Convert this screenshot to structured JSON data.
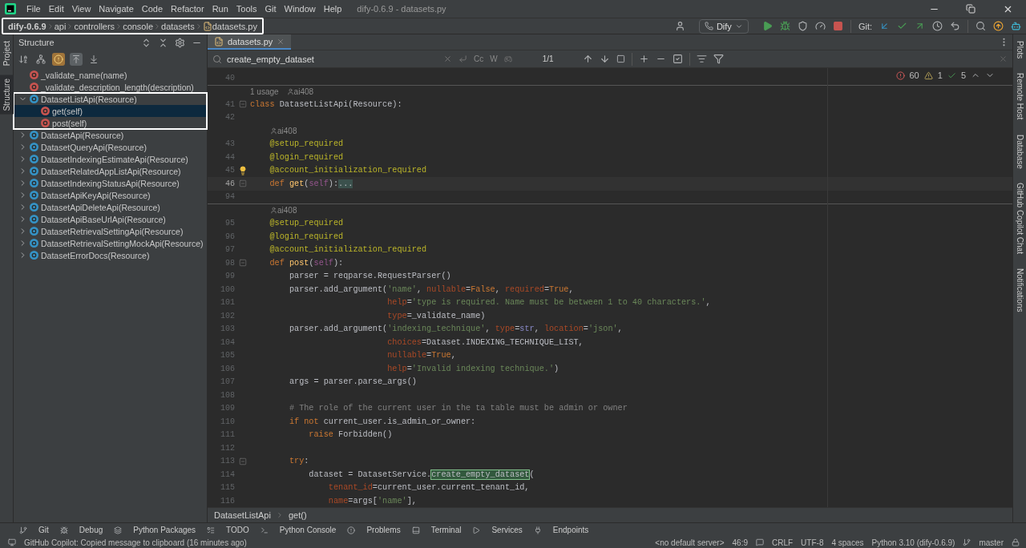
{
  "window": {
    "title": "dify-0.6.9 - datasets.py"
  },
  "menu": [
    "File",
    "Edit",
    "View",
    "Navigate",
    "Code",
    "Refactor",
    "Run",
    "Tools",
    "Git",
    "Window",
    "Help"
  ],
  "breadcrumb": {
    "framed": true,
    "items": [
      {
        "kind": "project",
        "text": "dify-0.6.9"
      },
      {
        "kind": "folder",
        "text": "api"
      },
      {
        "kind": "folder",
        "text": "controllers"
      },
      {
        "kind": "folder",
        "text": "console"
      },
      {
        "kind": "folder",
        "text": "datasets"
      },
      {
        "kind": "file",
        "text": "datasets.py"
      }
    ]
  },
  "toolbar": {
    "run_config": "Dify",
    "git_label": "Git:"
  },
  "left_stripe": [
    {
      "label": "Project",
      "selected": false
    },
    {
      "label": "Structure",
      "selected": true
    }
  ],
  "right_stripe": [
    "Plots",
    "Remote Host",
    "Database",
    "GitHub Copilot Chat",
    "Notifications"
  ],
  "structure": {
    "title": "Structure",
    "toggles": [
      {
        "kind": "sort",
        "on": false
      },
      {
        "kind": "hierarchy",
        "on": false
      },
      {
        "kind": "fields",
        "on": true
      },
      {
        "kind": "inherited",
        "on": true
      },
      {
        "kind": "down",
        "on": false
      }
    ],
    "items": [
      {
        "kind": "function",
        "text": "_validate_name(name)",
        "selected": false
      },
      {
        "kind": "function",
        "text": "_validate_description_length(description)",
        "selected": false
      },
      {
        "kind": "class",
        "text": "DatasetListApi(Resource)",
        "selected": false,
        "expanded": true,
        "framed": true,
        "children": [
          {
            "kind": "method",
            "text": "get(self)",
            "selected": true
          },
          {
            "kind": "method",
            "text": "post(self)",
            "selected": false
          }
        ]
      },
      {
        "kind": "class",
        "text": "DatasetApi(Resource)",
        "selected": false,
        "expanded": false
      },
      {
        "kind": "class",
        "text": "DatasetQueryApi(Resource)",
        "selected": false,
        "expanded": false
      },
      {
        "kind": "class",
        "text": "DatasetIndexingEstimateApi(Resource)",
        "selected": false,
        "expanded": false
      },
      {
        "kind": "class",
        "text": "DatasetRelatedAppListApi(Resource)",
        "selected": false,
        "expanded": false
      },
      {
        "kind": "class",
        "text": "DatasetIndexingStatusApi(Resource)",
        "selected": false,
        "expanded": false
      },
      {
        "kind": "class",
        "text": "DatasetApiKeyApi(Resource)",
        "selected": false,
        "expanded": false
      },
      {
        "kind": "class",
        "text": "DatasetApiDeleteApi(Resource)",
        "selected": false,
        "expanded": false
      },
      {
        "kind": "class",
        "text": "DatasetApiBaseUrlApi(Resource)",
        "selected": false,
        "expanded": false
      },
      {
        "kind": "class",
        "text": "DatasetRetrievalSettingApi(Resource)",
        "selected": false,
        "expanded": false
      },
      {
        "kind": "class",
        "text": "DatasetRetrievalSettingMockApi(Resource)",
        "selected": false,
        "expanded": false
      },
      {
        "kind": "class",
        "text": "DatasetErrorDocs(Resource)",
        "selected": false,
        "expanded": false
      }
    ]
  },
  "tabs": [
    {
      "label": "datasets.py",
      "selected": true
    }
  ],
  "find": {
    "value": "create_empty_dataset",
    "options": [
      "Cc",
      "W"
    ],
    "count": "1/1"
  },
  "inspections": {
    "errors": "60",
    "warnings": "1",
    "typos": "5"
  },
  "code": [
    {
      "kind": "line",
      "n": "40",
      "current": false
    },
    {
      "kind": "inlay",
      "separator": true,
      "nested": false,
      "usages": "1 usage",
      "author": "ai408"
    },
    {
      "kind": "line",
      "n": "41",
      "current": false,
      "foldable": true,
      "tokens": [
        {
          "kind": "k",
          "text": "class "
        },
        {
          "kind": "p",
          "text": "DatasetListApi(Resource):"
        }
      ]
    },
    {
      "kind": "line",
      "n": "42",
      "current": false
    },
    {
      "kind": "inlay",
      "separator": false,
      "nested": true,
      "author": "ai408"
    },
    {
      "kind": "line",
      "n": "43",
      "current": false,
      "tokens": [
        {
          "kind": "d",
          "text": "    @setup_required"
        }
      ]
    },
    {
      "kind": "line",
      "n": "44",
      "current": false,
      "tokens": [
        {
          "kind": "d",
          "text": "    @login_required"
        }
      ]
    },
    {
      "kind": "line",
      "n": "45",
      "current": false,
      "bulb": true,
      "tokens": [
        {
          "kind": "d",
          "text": "    @account_initialization_required"
        }
      ]
    },
    {
      "kind": "line",
      "n": "46",
      "current": true,
      "foldable": true,
      "tokens": [
        {
          "kind": "k",
          "text": "    def "
        },
        {
          "kind": "f",
          "text": "get"
        },
        {
          "kind": "p",
          "text": "("
        },
        {
          "kind": "s",
          "text": "self"
        },
        {
          "kind": "p",
          "text": "):"
        },
        {
          "kind": "fold",
          "text": "..."
        }
      ]
    },
    {
      "kind": "line",
      "n": "94",
      "current": false
    },
    {
      "kind": "inlay",
      "separator": true,
      "nested": true,
      "author": "ai408"
    },
    {
      "kind": "line",
      "n": "95",
      "current": false,
      "tokens": [
        {
          "kind": "d",
          "text": "    @setup_required"
        }
      ]
    },
    {
      "kind": "line",
      "n": "96",
      "current": false,
      "tokens": [
        {
          "kind": "d",
          "text": "    @login_required"
        }
      ]
    },
    {
      "kind": "line",
      "n": "97",
      "current": false,
      "tokens": [
        {
          "kind": "d",
          "text": "    @account_initialization_required"
        }
      ]
    },
    {
      "kind": "line",
      "n": "98",
      "current": false,
      "foldable": true,
      "tokens": [
        {
          "kind": "k",
          "text": "    def "
        },
        {
          "kind": "f",
          "text": "post"
        },
        {
          "kind": "p",
          "text": "("
        },
        {
          "kind": "s",
          "text": "self"
        },
        {
          "kind": "p",
          "text": "):"
        }
      ]
    },
    {
      "kind": "line",
      "n": "99",
      "current": false,
      "tokens": [
        {
          "kind": "p",
          "text": "        parser = reqparse.RequestParser()"
        }
      ]
    },
    {
      "kind": "line",
      "n": "100",
      "current": false,
      "tokens": [
        {
          "kind": "p",
          "text": "        parser.add_argument("
        },
        {
          "kind": "str",
          "text": "'name'"
        },
        {
          "kind": "p",
          "text": ", "
        },
        {
          "kind": "n",
          "text": "nullable"
        },
        {
          "kind": "p",
          "text": "="
        },
        {
          "kind": "k",
          "text": "False"
        },
        {
          "kind": "p",
          "text": ", "
        },
        {
          "kind": "n",
          "text": "required"
        },
        {
          "kind": "p",
          "text": "="
        },
        {
          "kind": "k",
          "text": "True"
        },
        {
          "kind": "p",
          "text": ","
        }
      ]
    },
    {
      "kind": "line",
      "n": "101",
      "current": false,
      "tokens": [
        {
          "kind": "n",
          "text": "                            help"
        },
        {
          "kind": "p",
          "text": "="
        },
        {
          "kind": "str",
          "text": "'type is required. Name must be between 1 to 40 characters.'"
        },
        {
          "kind": "p",
          "text": ","
        }
      ]
    },
    {
      "kind": "line",
      "n": "102",
      "current": false,
      "tokens": [
        {
          "kind": "n",
          "text": "                            type"
        },
        {
          "kind": "p",
          "text": "=_validate_name)"
        }
      ]
    },
    {
      "kind": "line",
      "n": "103",
      "current": false,
      "tokens": [
        {
          "kind": "p",
          "text": "        parser.add_argument("
        },
        {
          "kind": "str",
          "text": "'indexing_technique'"
        },
        {
          "kind": "p",
          "text": ", "
        },
        {
          "kind": "n",
          "text": "type"
        },
        {
          "kind": "p",
          "text": "="
        },
        {
          "kind": "b",
          "text": "str"
        },
        {
          "kind": "p",
          "text": ", "
        },
        {
          "kind": "n",
          "text": "location"
        },
        {
          "kind": "p",
          "text": "="
        },
        {
          "kind": "str",
          "text": "'json'"
        },
        {
          "kind": "p",
          "text": ","
        }
      ]
    },
    {
      "kind": "line",
      "n": "104",
      "current": false,
      "tokens": [
        {
          "kind": "n",
          "text": "                            choices"
        },
        {
          "kind": "p",
          "text": "=Dataset.INDEXING_TECHNIQUE_LIST,"
        }
      ]
    },
    {
      "kind": "line",
      "n": "105",
      "current": false,
      "tokens": [
        {
          "kind": "n",
          "text": "                            nullable"
        },
        {
          "kind": "p",
          "text": "="
        },
        {
          "kind": "k",
          "text": "True"
        },
        {
          "kind": "p",
          "text": ","
        }
      ]
    },
    {
      "kind": "line",
      "n": "106",
      "current": false,
      "tokens": [
        {
          "kind": "n",
          "text": "                            help"
        },
        {
          "kind": "p",
          "text": "="
        },
        {
          "kind": "str",
          "text": "'Invalid indexing technique.'"
        },
        {
          "kind": "p",
          "text": ")"
        }
      ]
    },
    {
      "kind": "line",
      "n": "107",
      "current": false,
      "tokens": [
        {
          "kind": "p",
          "text": "        args = parser.parse_args()"
        }
      ]
    },
    {
      "kind": "line",
      "n": "108",
      "current": false
    },
    {
      "kind": "line",
      "n": "109",
      "current": false,
      "tokens": [
        {
          "kind": "c",
          "text": "        # The role of the current user in the ta table must be admin or owner"
        }
      ]
    },
    {
      "kind": "line",
      "n": "110",
      "current": false,
      "tokens": [
        {
          "kind": "k",
          "text": "        if not "
        },
        {
          "kind": "p",
          "text": "current_user.is_admin_or_owner:"
        }
      ]
    },
    {
      "kind": "line",
      "n": "111",
      "current": false,
      "tokens": [
        {
          "kind": "k",
          "text": "            raise "
        },
        {
          "kind": "p",
          "text": "Forbidden()"
        }
      ]
    },
    {
      "kind": "line",
      "n": "112",
      "current": false
    },
    {
      "kind": "line",
      "n": "113",
      "current": false,
      "foldable": true,
      "tokens": [
        {
          "kind": "k",
          "text": "        try"
        },
        {
          "kind": "p",
          "text": ":"
        }
      ]
    },
    {
      "kind": "line",
      "n": "114",
      "current": false,
      "tokens": [
        {
          "kind": "p",
          "text": "            dataset = DatasetService."
        },
        {
          "kind": "hit",
          "text": "create_empty_dataset"
        },
        {
          "kind": "p",
          "text": "("
        }
      ]
    },
    {
      "kind": "line",
      "n": "115",
      "current": false,
      "tokens": [
        {
          "kind": "n",
          "text": "                tenant_id"
        },
        {
          "kind": "p",
          "text": "=current_user.current_tenant_id,"
        }
      ]
    },
    {
      "kind": "line",
      "n": "116",
      "current": false,
      "tokens": [
        {
          "kind": "n",
          "text": "                name"
        },
        {
          "kind": "p",
          "text": "=args["
        },
        {
          "kind": "str",
          "text": "'name'"
        },
        {
          "kind": "p",
          "text": "],"
        }
      ]
    }
  ],
  "editor_breadcrumb": [
    "DatasetListApi",
    "get()"
  ],
  "tool_windows": [
    {
      "kind": "git",
      "label": "Git"
    },
    {
      "kind": "debug",
      "label": "Debug"
    },
    {
      "kind": "packages",
      "label": "Python Packages"
    },
    {
      "kind": "todo",
      "label": "TODO"
    },
    {
      "kind": "console",
      "label": "Python Console"
    },
    {
      "kind": "problems",
      "label": "Problems"
    },
    {
      "kind": "terminal",
      "label": "Terminal"
    },
    {
      "kind": "services",
      "label": "Services"
    },
    {
      "kind": "endpoints",
      "label": "Endpoints"
    }
  ],
  "status": {
    "message": "GitHub Copilot: Copied message to clipboard (16 minutes ago)",
    "server": "<no default server>",
    "position": "46:9",
    "line_sep": "CRLF",
    "encoding": "UTF-8",
    "indent": "4 spaces",
    "interpreter": "Python 3.10 (dify-0.6.9)",
    "branch": "master"
  }
}
